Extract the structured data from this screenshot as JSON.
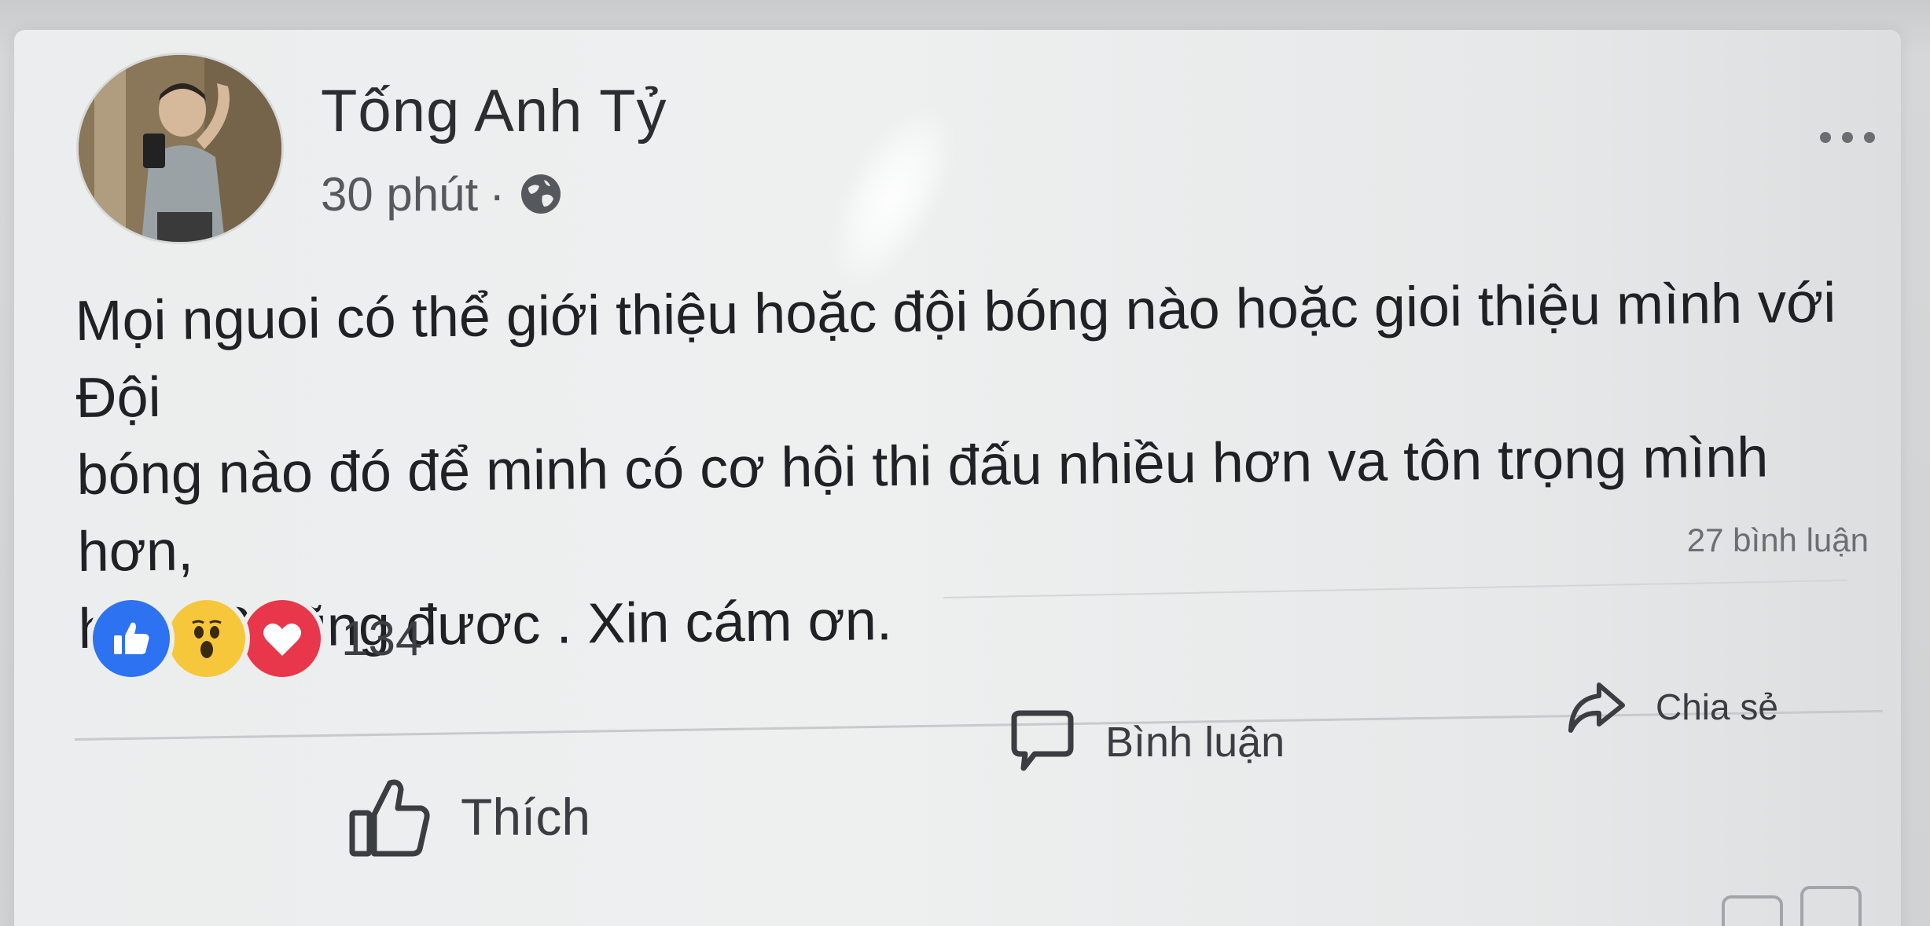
{
  "post": {
    "author_name": "Tống Anh Tỷ",
    "timestamp": "30 phút",
    "separator": "·",
    "privacy_icon": "globe-icon",
    "more_icon": "more-options-icon",
    "text_lines": [
      "Mọi nguoi có thể giới thiệu hoặc đội bóng nào hoặc gioi thiệu mình với Đội",
      "bóng nào đó để minh có cơ hội thi đấu nhiều hơn va tôn trọng mình hơn,",
      "hạng 2 cũng đươc . Xin cám ơn."
    ],
    "comment_count": "27 bình luận",
    "reactions": {
      "icons": [
        "like-reaction-icon",
        "wow-reaction-icon",
        "love-reaction-icon"
      ],
      "count": "134"
    }
  },
  "actions": {
    "like_label": "Thích",
    "comment_label": "Bình luận",
    "share_label": "Chia sẻ"
  },
  "colors": {
    "like_blue": "#2d72f0",
    "wow_yellow": "#f7c73b",
    "love_red": "#e8364b",
    "text": "#1f2124"
  }
}
